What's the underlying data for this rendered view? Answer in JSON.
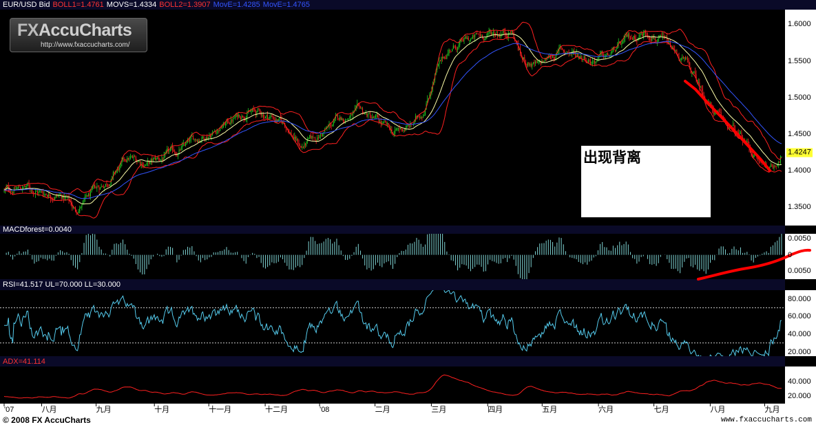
{
  "header": {
    "symbol": "EUR/USD Bid",
    "readouts": [
      {
        "text": "BOLL1=1.4761",
        "color": "#ff3333"
      },
      {
        "text": "MOVS=1.4334",
        "color": "#ffffff"
      },
      {
        "text": "BOLL2=1.3907",
        "color": "#ff3333"
      },
      {
        "text": "MovE=1.4285",
        "color": "#3355ff"
      },
      {
        "text": "MovE=1.4765",
        "color": "#3355ff"
      }
    ]
  },
  "logo": {
    "brand_fx": "FX",
    "brand_name": "AccuCharts",
    "url": "http://www.fxaccucharts.com/"
  },
  "annotation_box": {
    "text": "出现背离"
  },
  "footer": {
    "copyright": "© 2008 FX AccuCharts",
    "url": "www.fxaccucharts.com"
  },
  "colors": {
    "background": "#000000",
    "candle_up": "#22cc22",
    "candle_down": "#ff2020",
    "bollinger": "#ff2020",
    "sma": "#ffffaa",
    "ema": "#3355ff",
    "macd_hist": "#7fd4d4",
    "rsi": "#55ccee",
    "adx": "#ff2020",
    "annotation": "#ff0000",
    "last_price_badge": "#ffff33"
  },
  "chart_data": [
    {
      "type": "candlestick",
      "title": "EUR/USD Bid",
      "ylim": [
        1.325,
        1.62
      ],
      "yticks": [
        "1.6000",
        "1.5500",
        "1.5000",
        "1.4500",
        "1.4000",
        "1.3500"
      ],
      "ytick_values": [
        1.6,
        1.55,
        1.5,
        1.45,
        1.4,
        1.35
      ],
      "last_price": "1.4247",
      "last_price_value": 1.4247,
      "x_labels": [
        "'07",
        "八月",
        "九月",
        "十月",
        "十一月",
        "十二月",
        "'08",
        "二月",
        "三月",
        "四月",
        "五月",
        "六月",
        "七月",
        "八月",
        "九月"
      ],
      "trend_anchors": [
        [
          0,
          1.372
        ],
        [
          20,
          1.378
        ],
        [
          35,
          1.37
        ],
        [
          46,
          1.37
        ],
        [
          58,
          1.362
        ],
        [
          66,
          1.345
        ],
        [
          76,
          1.36
        ],
        [
          95,
          1.385
        ],
        [
          115,
          1.415
        ],
        [
          135,
          1.41
        ],
        [
          160,
          1.425
        ],
        [
          180,
          1.445
        ],
        [
          200,
          1.46
        ],
        [
          225,
          1.482
        ],
        [
          250,
          1.473
        ],
        [
          262,
          1.46
        ],
        [
          275,
          1.432
        ],
        [
          290,
          1.445
        ],
        [
          310,
          1.47
        ],
        [
          330,
          1.48
        ],
        [
          345,
          1.468
        ],
        [
          360,
          1.45
        ],
        [
          378,
          1.462
        ],
        [
          388,
          1.482
        ],
        [
          400,
          1.535
        ],
        [
          412,
          1.565
        ],
        [
          425,
          1.575
        ],
        [
          440,
          1.583
        ],
        [
          458,
          1.59
        ],
        [
          470,
          1.592
        ],
        [
          480,
          1.552
        ],
        [
          495,
          1.542
        ],
        [
          515,
          1.565
        ],
        [
          530,
          1.56
        ],
        [
          545,
          1.553
        ],
        [
          560,
          1.556
        ],
        [
          575,
          1.575
        ],
        [
          590,
          1.588
        ],
        [
          600,
          1.59
        ],
        [
          612,
          1.573
        ],
        [
          625,
          1.555
        ],
        [
          632,
          1.545
        ],
        [
          645,
          1.512
        ],
        [
          660,
          1.475
        ],
        [
          675,
          1.455
        ],
        [
          690,
          1.432
        ],
        [
          700,
          1.41
        ],
        [
          712,
          1.405
        ],
        [
          720,
          1.425
        ]
      ],
      "series": [
        {
          "name": "BOLL1",
          "value": 1.4761
        },
        {
          "name": "MOVS",
          "value": 1.4334
        },
        {
          "name": "BOLL2",
          "value": 1.3907
        },
        {
          "name": "MovE",
          "value": 1.4285
        },
        {
          "name": "MovE",
          "value": 1.4765
        }
      ]
    },
    {
      "type": "bar",
      "title": "MACDforest=0.0040",
      "ylim": [
        -0.0075,
        0.0065
      ],
      "yticks": [
        "0.0050",
        "0",
        "0.0050"
      ],
      "ytick_values": [
        0.005,
        0,
        -0.005
      ]
    },
    {
      "type": "line",
      "title": "RSI=41.517  UL=70.000  LL=30.000",
      "ylim": [
        15,
        90
      ],
      "upper_level": 70,
      "lower_level": 30,
      "yticks": [
        "80.000",
        "60.000",
        "40.000",
        "20.000"
      ],
      "ytick_values": [
        80,
        60,
        40,
        20
      ]
    },
    {
      "type": "line",
      "title": "ADX=41.114",
      "ylim": [
        10,
        60
      ],
      "yticks": [
        "40.000",
        "20.000"
      ],
      "ytick_values": [
        40,
        20
      ]
    }
  ]
}
